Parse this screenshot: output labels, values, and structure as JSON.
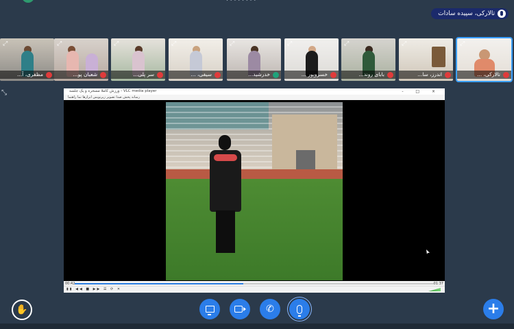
{
  "top": {
    "garbled_text": "، ، ، ، ، ، ، ،"
  },
  "presenter": {
    "name": "تالارکی، سپیده سادات"
  },
  "participants": [
    {
      "name": "مظفری، آ...",
      "mic": "muted"
    },
    {
      "name": "شعبان پو...",
      "mic": "muted"
    },
    {
      "name": "سر پلی...",
      "mic": "muted"
    },
    {
      "name": "سیفی، ...",
      "mic": "muted"
    },
    {
      "name": "خدرشید...",
      "mic": "headset"
    },
    {
      "name": "خسروپور ...",
      "mic": "muted"
    },
    {
      "name": "بابای روند...",
      "mic": "muted"
    },
    {
      "name": "اندرز، سا...",
      "mic": "muted"
    },
    {
      "name": "تالارکی، ...",
      "mic": "muted"
    }
  ],
  "shared_window": {
    "title": "ورزش کاملا مسخره و یک جلسه - VLC media player",
    "menu": "رسانه  پخش  صدا  تصویر  زیرنویس  ابزارها  نما  راهنما",
    "window_controls": "- □ ×",
    "time_elapsed": "00:42",
    "time_total": "01:37",
    "progress": 0.47,
    "controls_glyphs": "▮▮ ◀◀ ■ ▶▶ ☰ ⟳ ✕"
  },
  "toolbar": {
    "raise_hand_icon": "hand-icon",
    "share_icon": "screen-share-icon",
    "camera_icon": "camera-icon",
    "phone_icon": "phone-icon",
    "mic_icon": "microphone-icon",
    "plus_label": "+"
  },
  "colors": {
    "background": "#2b3a4b",
    "accent": "#2b7de9",
    "muted": "#e03b3b",
    "presenter_chip": "#1b2a6b"
  }
}
